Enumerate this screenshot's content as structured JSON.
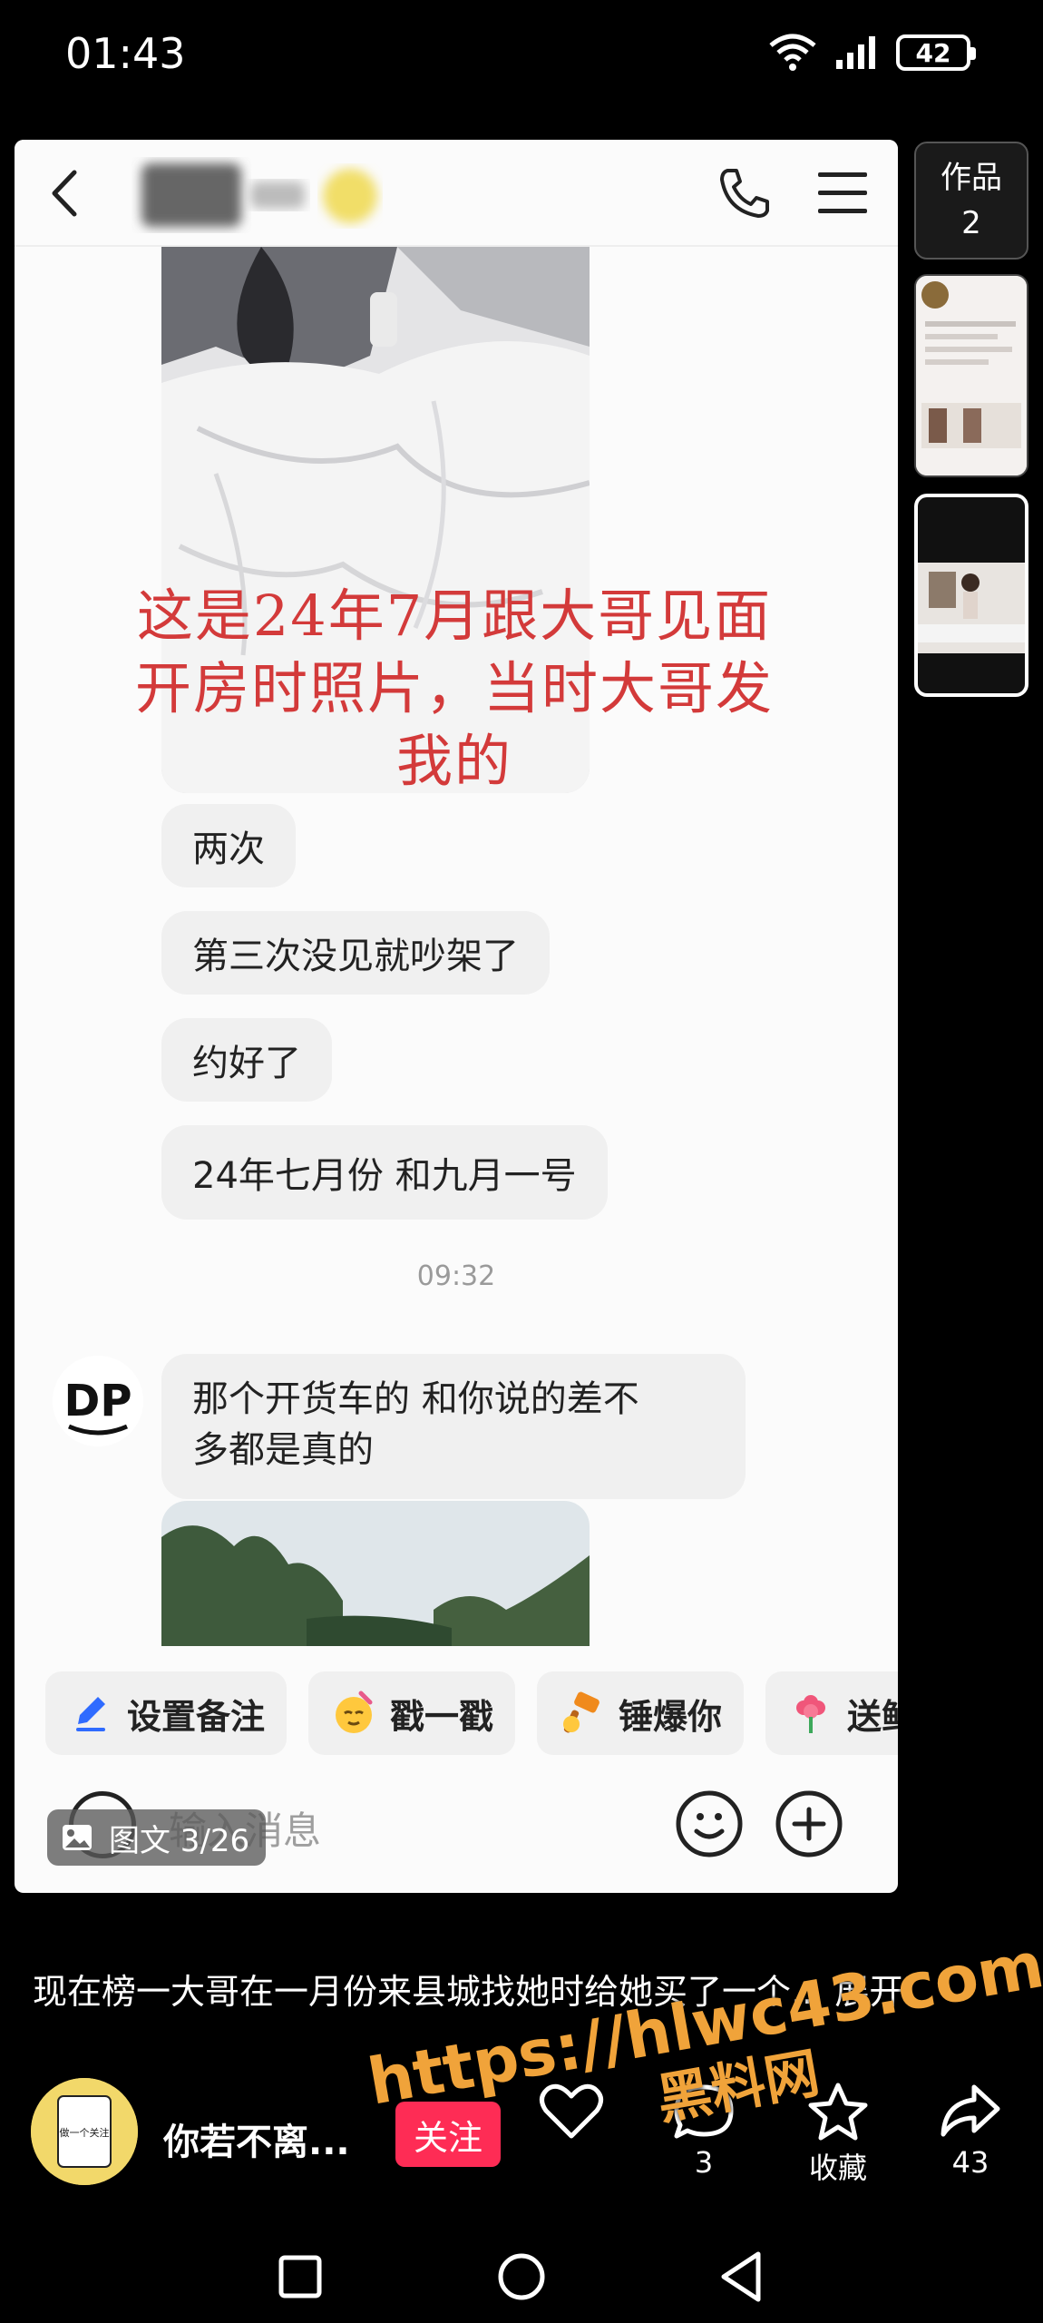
{
  "status_bar": {
    "time": "01:43",
    "battery": "42"
  },
  "chat": {
    "overlay_text": [
      "这是24年7月跟大哥见面",
      "开房时照片，当时大哥发",
      "我的"
    ],
    "messages_outgoing": [
      "两次",
      "第三次没见就吵架了",
      "约好了",
      "24年七月份 和九月一号"
    ],
    "timestamp": "09:32",
    "incoming_message": [
      "那个开货车的 和你说的差不",
      "多都是真的"
    ],
    "avatar_text": "DP"
  },
  "quick_actions": [
    {
      "label": "设置备注",
      "icon": "pencil-icon"
    },
    {
      "label": "戳一戳",
      "icon": "poke-emoji-icon"
    },
    {
      "label": "锤爆你",
      "icon": "hammer-icon"
    },
    {
      "label": "送鲜花",
      "icon": "flower-icon"
    }
  ],
  "input": {
    "placeholder": "输入消息"
  },
  "page_indicator": "图文 3/26",
  "side_rail": {
    "works_label": "作品",
    "works_count": "2"
  },
  "caption": "现在榜一大哥在一月份来县城找她时给她买了一个... 展开",
  "author": {
    "name": "你若不离...",
    "follow_label": "关注",
    "avatar_text": "做一个关注"
  },
  "actions": {
    "comments": "3",
    "collect_label": "收藏",
    "share_count": "43"
  },
  "watermark": {
    "url": "https://hlwc43.com",
    "subtitle": "黑料网"
  },
  "colors": {
    "accent_follow": "#fe2c55",
    "overlay_text": "#d33a3a",
    "watermark": "#f0a33a"
  }
}
